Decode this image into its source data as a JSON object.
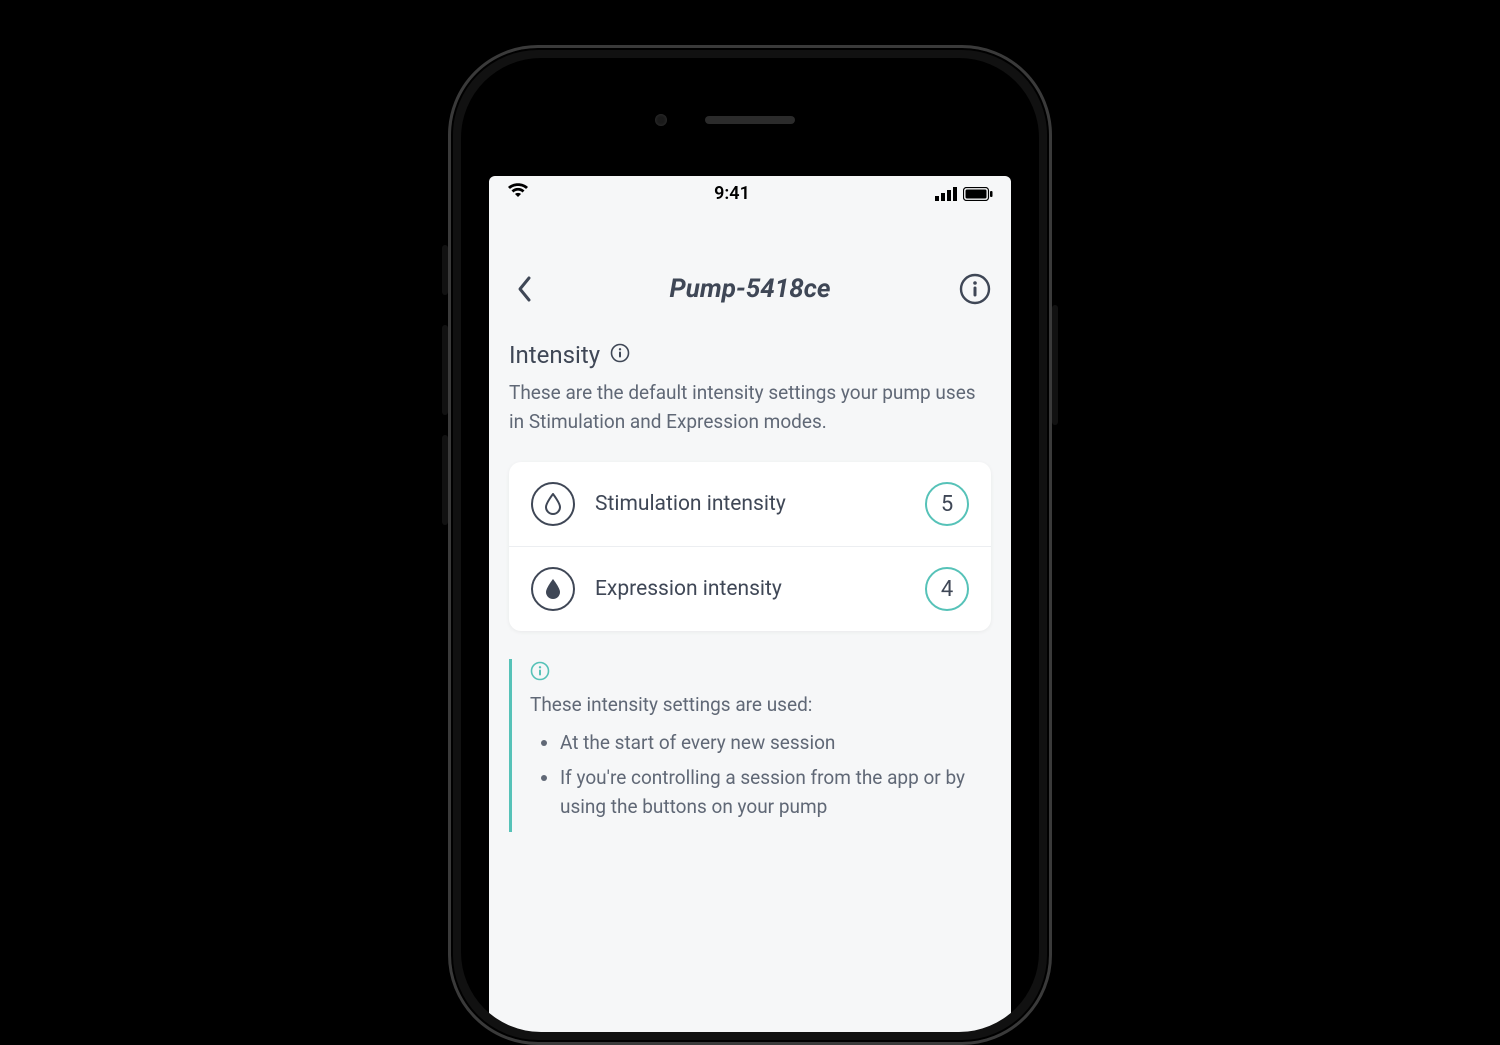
{
  "statusBar": {
    "time": "9:41"
  },
  "header": {
    "title": "Pump-5418ce"
  },
  "section": {
    "title": "Intensity",
    "description": "These are the default intensity settings your pump uses in Stimulation and Expression modes."
  },
  "rows": {
    "stimulation": {
      "label": "Stimulation intensity",
      "value": "5"
    },
    "expression": {
      "label": "Expression intensity",
      "value": "4"
    }
  },
  "info": {
    "lead": "These intensity settings are used:",
    "bullets": [
      "At the start of every new session",
      "If you're controlling a session from the app or by using the buttons on your pump"
    ]
  },
  "colors": {
    "accent": "#56c2b8",
    "text": "#3f4756",
    "muted": "#606876"
  }
}
